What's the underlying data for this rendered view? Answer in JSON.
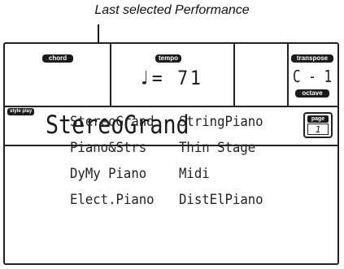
{
  "annotation": {
    "caption": "Last selected Performance"
  },
  "top_bar": {
    "chord_label": "chord",
    "tempo_label": "tempo",
    "tempo_value": "♩= 71",
    "transpose_label": "transpose",
    "transpose_value": "C - 1",
    "octave_label": "octave"
  },
  "title_bar": {
    "mode_tag": "style play",
    "performance_name": "StereoGrand",
    "page_label": "page",
    "page_number": "1"
  },
  "performances": [
    [
      "StereoGrand",
      "StringPiano"
    ],
    [
      "Piano&Strs",
      "Thin Stage"
    ],
    [
      "DyMy Piano",
      "Midi"
    ],
    [
      "Elect.Piano",
      "DistElPiano"
    ]
  ]
}
